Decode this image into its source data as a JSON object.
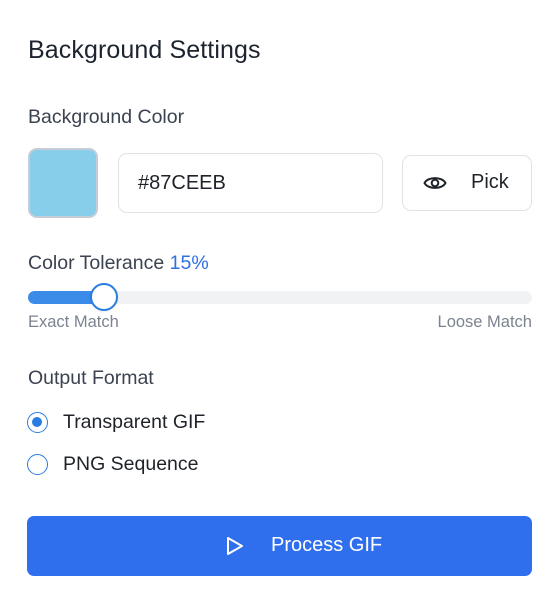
{
  "panel": {
    "title": "Background Settings"
  },
  "background_color": {
    "label": "Background Color",
    "swatch_color": "#87CEEB",
    "hex_value": "#87CEEB",
    "pick_button": {
      "icon": "eye-icon",
      "label": "Pick"
    }
  },
  "tolerance": {
    "label": "Color Tolerance",
    "value_text": "15%",
    "value": 15,
    "min_label": "Exact Match",
    "max_label": "Loose Match",
    "accent_color": "#3b8be8"
  },
  "output_format": {
    "label": "Output Format",
    "options": [
      {
        "label": "Transparent GIF",
        "selected": true
      },
      {
        "label": "PNG Sequence",
        "selected": false
      }
    ]
  },
  "process_button": {
    "icon": "play-icon",
    "label": "Process GIF",
    "color": "#2f6fee"
  }
}
